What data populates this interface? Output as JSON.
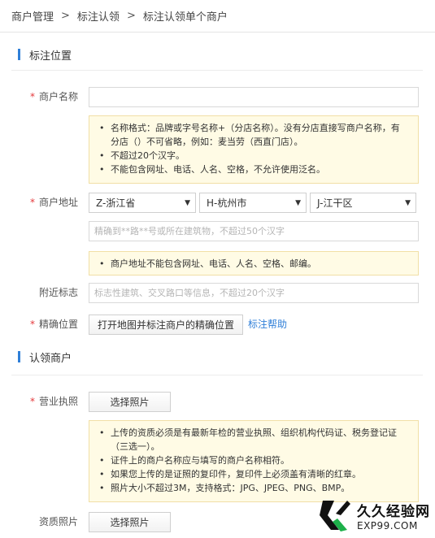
{
  "breadcrumb": {
    "items": [
      "商户管理",
      "标注认领",
      "标注认领单个商户"
    ],
    "separator": ">"
  },
  "section_location": {
    "title": "标注位置"
  },
  "merchant_name": {
    "label": "商户名称",
    "required_mark": "*",
    "value": "",
    "placeholder": "",
    "tips": [
      "名称格式：品牌或字号名称+（分店名称）。没有分店直接写商户名称，有分店（）不可省略，例如：麦当劳（西直门店）。",
      "不超过20个汉字。",
      "不能包含网址、电话、人名、空格，不允许使用泛名。"
    ]
  },
  "merchant_address": {
    "label": "商户地址",
    "required_mark": "*",
    "province": "Z-浙江省",
    "city": "H-杭州市",
    "district": "J-江干区",
    "placeholder": "精确到**路**号或所在建筑物，不超过50个汉字",
    "tips": [
      "商户地址不能包含网址、电话、人名、空格、邮编。"
    ]
  },
  "nearby_landmark": {
    "label": "附近标志",
    "placeholder": "标志性建筑、交叉路口等信息，不超过20个汉字"
  },
  "precise_location": {
    "label": "精确位置",
    "required_mark": "*",
    "button": "打开地图并标注商户的精确位置",
    "help_link": "标注帮助"
  },
  "section_claim": {
    "title": "认领商户"
  },
  "business_license": {
    "label": "营业执照",
    "required_mark": "*",
    "button": "选择照片",
    "tips": [
      "上传的资质必须是有最新年检的营业执照、组织机构代码证、税务登记证（三选一）。",
      "证件上的商户名称应与填写的商户名称相符。",
      "如果您上传的是证照的复印件，复印件上必须盖有清晰的红章。",
      "照片大小不超过3M，支持格式：JPG、JPEG、PNG、BMP。"
    ]
  },
  "qualification_photo": {
    "label": "资质照片",
    "button": "选择照片"
  },
  "watermark": {
    "cn": "久久经验网",
    "en": "EXP99.COM"
  },
  "colors": {
    "accent": "#2f7fd8",
    "required": "#e4393c",
    "tip_bg": "#fffbe5",
    "tip_border": "#f1dfa6"
  }
}
